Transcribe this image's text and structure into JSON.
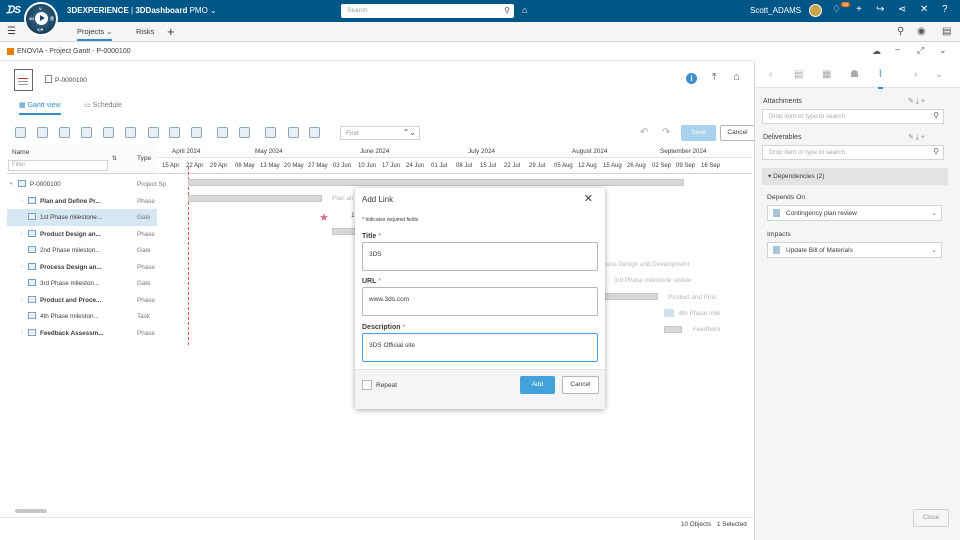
{
  "topbar": {
    "brand_prefix": "3DEXPERIENCE",
    "brand_app": "3DDashboard",
    "brand_dash": "PMO",
    "search_placeholder": "Search",
    "user": "Scott_ADAMS",
    "notif_count": "12",
    "compass_left": "3D",
    "compass_top": "V",
    "compass_right": "Ⓡ",
    "compass_bottom": "V,R"
  },
  "tabs": {
    "projects": "Projects",
    "risks": "Risks"
  },
  "panel": {
    "title": "ENOVIA - Project Gantt - P-0000100",
    "project_id": "P-0000100"
  },
  "subtabs": {
    "gantt": "Gantt view",
    "schedule": "Schedule"
  },
  "toolbar": {
    "find_placeholder": "Find",
    "save": "Save",
    "cancel": "Cancel"
  },
  "grid": {
    "col_name": "Name",
    "col_type": "Type",
    "filter_placeholder": "Filter",
    "rows": [
      {
        "name": "P-0000100",
        "type": "Project Sp"
      },
      {
        "name": "Plan and Define Pr...",
        "type": "Phase"
      },
      {
        "name": "1st Phase milestone...",
        "type": "Gate"
      },
      {
        "name": "Product Design an...",
        "type": "Phase"
      },
      {
        "name": "2nd Phase mileston...",
        "type": "Gate"
      },
      {
        "name": "Process Design an...",
        "type": "Phase"
      },
      {
        "name": "3rd Phase mileston...",
        "type": "Gate"
      },
      {
        "name": "Product and Proce...",
        "type": "Phase"
      },
      {
        "name": "4th Phase mileston...",
        "type": "Task"
      },
      {
        "name": "Feedback Assessm...",
        "type": "Phase"
      }
    ]
  },
  "gantt": {
    "months": [
      "April 2024",
      "May 2024",
      "June 2024",
      "July 2024",
      "August 2024",
      "September 2024"
    ],
    "weeks": [
      "15 Apr",
      "22 Apr",
      "29 Apr",
      "06 May",
      "13 May",
      "20 May",
      "27 May",
      "03 Jun",
      "10 Jun",
      "17 Jun",
      "24 Jun",
      "01 Jul",
      "08 Jul",
      "15 Jul",
      "22 Jul",
      "29 Jul",
      "05 Aug",
      "12 Aug",
      "15 Aug",
      "26 Aug",
      "02 Sep",
      "09 Sep",
      "16 Sep"
    ],
    "ghost_labels": [
      "Plan an",
      "1",
      "cess Design and Development",
      "3rd Phase milestone review",
      "Product and Proc",
      "4th Phase mile",
      "Feedback"
    ]
  },
  "right": {
    "attachments": "Attachments",
    "attach_placeholder": "Drop item or type to search",
    "deliverables": "Deliverables",
    "deliv_placeholder": "Drop item or type to search",
    "deps_header": "Dependencies (2)",
    "depends_on": "Depends On",
    "depends_item": "Contingency plan review",
    "impacts": "Impacts",
    "impacts_item": "Update Bill of Materials",
    "close": "Close"
  },
  "status": {
    "objects": "10 Objects",
    "selected": "1 Selected"
  },
  "modal": {
    "title": "Add Link",
    "required_note": "* Indicates required fields",
    "title_label": "Title",
    "title_value": "3DS",
    "url_label": "URL",
    "url_value": "www.3ds.com",
    "desc_label": "Description",
    "desc_value": "3DS Official site",
    "repeat": "Repeat",
    "add": "Add",
    "cancel": "Cancel"
  }
}
